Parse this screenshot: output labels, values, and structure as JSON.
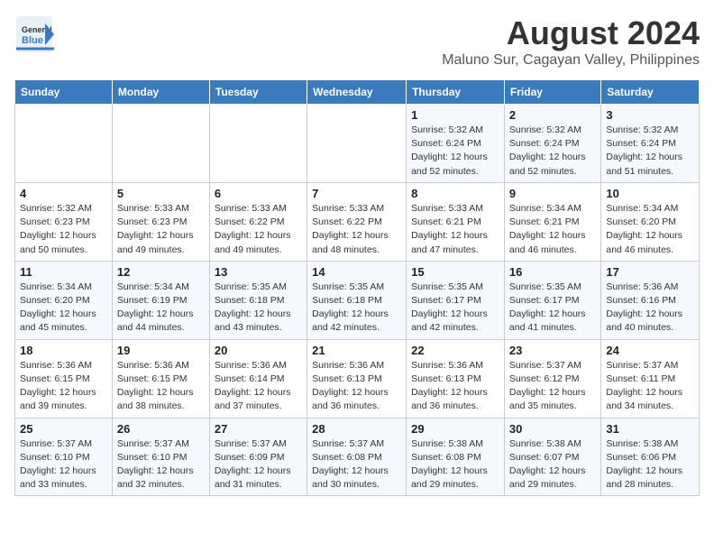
{
  "header": {
    "logo_general": "General",
    "logo_blue": "Blue",
    "title": "August 2024",
    "subtitle": "Maluno Sur, Cagayan Valley, Philippines"
  },
  "calendar": {
    "weekdays": [
      "Sunday",
      "Monday",
      "Tuesday",
      "Wednesday",
      "Thursday",
      "Friday",
      "Saturday"
    ],
    "weeks": [
      [
        {
          "day": "",
          "info": ""
        },
        {
          "day": "",
          "info": ""
        },
        {
          "day": "",
          "info": ""
        },
        {
          "day": "",
          "info": ""
        },
        {
          "day": "1",
          "info": "Sunrise: 5:32 AM\nSunset: 6:24 PM\nDaylight: 12 hours\nand 52 minutes."
        },
        {
          "day": "2",
          "info": "Sunrise: 5:32 AM\nSunset: 6:24 PM\nDaylight: 12 hours\nand 52 minutes."
        },
        {
          "day": "3",
          "info": "Sunrise: 5:32 AM\nSunset: 6:24 PM\nDaylight: 12 hours\nand 51 minutes."
        }
      ],
      [
        {
          "day": "4",
          "info": "Sunrise: 5:32 AM\nSunset: 6:23 PM\nDaylight: 12 hours\nand 50 minutes."
        },
        {
          "day": "5",
          "info": "Sunrise: 5:33 AM\nSunset: 6:23 PM\nDaylight: 12 hours\nand 49 minutes."
        },
        {
          "day": "6",
          "info": "Sunrise: 5:33 AM\nSunset: 6:22 PM\nDaylight: 12 hours\nand 49 minutes."
        },
        {
          "day": "7",
          "info": "Sunrise: 5:33 AM\nSunset: 6:22 PM\nDaylight: 12 hours\nand 48 minutes."
        },
        {
          "day": "8",
          "info": "Sunrise: 5:33 AM\nSunset: 6:21 PM\nDaylight: 12 hours\nand 47 minutes."
        },
        {
          "day": "9",
          "info": "Sunrise: 5:34 AM\nSunset: 6:21 PM\nDaylight: 12 hours\nand 46 minutes."
        },
        {
          "day": "10",
          "info": "Sunrise: 5:34 AM\nSunset: 6:20 PM\nDaylight: 12 hours\nand 46 minutes."
        }
      ],
      [
        {
          "day": "11",
          "info": "Sunrise: 5:34 AM\nSunset: 6:20 PM\nDaylight: 12 hours\nand 45 minutes."
        },
        {
          "day": "12",
          "info": "Sunrise: 5:34 AM\nSunset: 6:19 PM\nDaylight: 12 hours\nand 44 minutes."
        },
        {
          "day": "13",
          "info": "Sunrise: 5:35 AM\nSunset: 6:18 PM\nDaylight: 12 hours\nand 43 minutes."
        },
        {
          "day": "14",
          "info": "Sunrise: 5:35 AM\nSunset: 6:18 PM\nDaylight: 12 hours\nand 42 minutes."
        },
        {
          "day": "15",
          "info": "Sunrise: 5:35 AM\nSunset: 6:17 PM\nDaylight: 12 hours\nand 42 minutes."
        },
        {
          "day": "16",
          "info": "Sunrise: 5:35 AM\nSunset: 6:17 PM\nDaylight: 12 hours\nand 41 minutes."
        },
        {
          "day": "17",
          "info": "Sunrise: 5:36 AM\nSunset: 6:16 PM\nDaylight: 12 hours\nand 40 minutes."
        }
      ],
      [
        {
          "day": "18",
          "info": "Sunrise: 5:36 AM\nSunset: 6:15 PM\nDaylight: 12 hours\nand 39 minutes."
        },
        {
          "day": "19",
          "info": "Sunrise: 5:36 AM\nSunset: 6:15 PM\nDaylight: 12 hours\nand 38 minutes."
        },
        {
          "day": "20",
          "info": "Sunrise: 5:36 AM\nSunset: 6:14 PM\nDaylight: 12 hours\nand 37 minutes."
        },
        {
          "day": "21",
          "info": "Sunrise: 5:36 AM\nSunset: 6:13 PM\nDaylight: 12 hours\nand 36 minutes."
        },
        {
          "day": "22",
          "info": "Sunrise: 5:36 AM\nSunset: 6:13 PM\nDaylight: 12 hours\nand 36 minutes."
        },
        {
          "day": "23",
          "info": "Sunrise: 5:37 AM\nSunset: 6:12 PM\nDaylight: 12 hours\nand 35 minutes."
        },
        {
          "day": "24",
          "info": "Sunrise: 5:37 AM\nSunset: 6:11 PM\nDaylight: 12 hours\nand 34 minutes."
        }
      ],
      [
        {
          "day": "25",
          "info": "Sunrise: 5:37 AM\nSunset: 6:10 PM\nDaylight: 12 hours\nand 33 minutes."
        },
        {
          "day": "26",
          "info": "Sunrise: 5:37 AM\nSunset: 6:10 PM\nDaylight: 12 hours\nand 32 minutes."
        },
        {
          "day": "27",
          "info": "Sunrise: 5:37 AM\nSunset: 6:09 PM\nDaylight: 12 hours\nand 31 minutes."
        },
        {
          "day": "28",
          "info": "Sunrise: 5:37 AM\nSunset: 6:08 PM\nDaylight: 12 hours\nand 30 minutes."
        },
        {
          "day": "29",
          "info": "Sunrise: 5:38 AM\nSunset: 6:08 PM\nDaylight: 12 hours\nand 29 minutes."
        },
        {
          "day": "30",
          "info": "Sunrise: 5:38 AM\nSunset: 6:07 PM\nDaylight: 12 hours\nand 29 minutes."
        },
        {
          "day": "31",
          "info": "Sunrise: 5:38 AM\nSunset: 6:06 PM\nDaylight: 12 hours\nand 28 minutes."
        }
      ]
    ]
  }
}
